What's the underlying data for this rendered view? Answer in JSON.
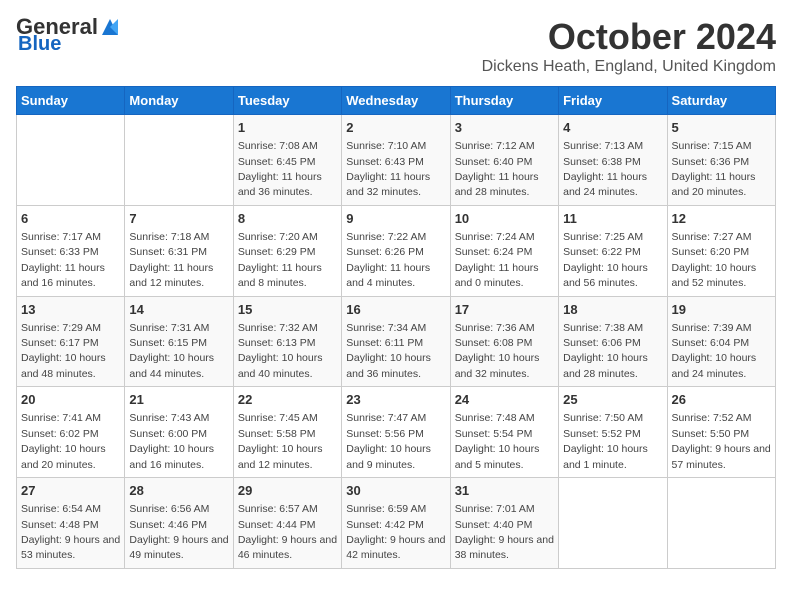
{
  "header": {
    "logo_general": "General",
    "logo_blue": "Blue",
    "main_title": "October 2024",
    "subtitle": "Dickens Heath, England, United Kingdom"
  },
  "days_of_week": [
    "Sunday",
    "Monday",
    "Tuesday",
    "Wednesday",
    "Thursday",
    "Friday",
    "Saturday"
  ],
  "weeks": [
    [
      {
        "day": "",
        "info": ""
      },
      {
        "day": "",
        "info": ""
      },
      {
        "day": "1",
        "info": "Sunrise: 7:08 AM\nSunset: 6:45 PM\nDaylight: 11 hours and 36 minutes."
      },
      {
        "day": "2",
        "info": "Sunrise: 7:10 AM\nSunset: 6:43 PM\nDaylight: 11 hours and 32 minutes."
      },
      {
        "day": "3",
        "info": "Sunrise: 7:12 AM\nSunset: 6:40 PM\nDaylight: 11 hours and 28 minutes."
      },
      {
        "day": "4",
        "info": "Sunrise: 7:13 AM\nSunset: 6:38 PM\nDaylight: 11 hours and 24 minutes."
      },
      {
        "day": "5",
        "info": "Sunrise: 7:15 AM\nSunset: 6:36 PM\nDaylight: 11 hours and 20 minutes."
      }
    ],
    [
      {
        "day": "6",
        "info": "Sunrise: 7:17 AM\nSunset: 6:33 PM\nDaylight: 11 hours and 16 minutes."
      },
      {
        "day": "7",
        "info": "Sunrise: 7:18 AM\nSunset: 6:31 PM\nDaylight: 11 hours and 12 minutes."
      },
      {
        "day": "8",
        "info": "Sunrise: 7:20 AM\nSunset: 6:29 PM\nDaylight: 11 hours and 8 minutes."
      },
      {
        "day": "9",
        "info": "Sunrise: 7:22 AM\nSunset: 6:26 PM\nDaylight: 11 hours and 4 minutes."
      },
      {
        "day": "10",
        "info": "Sunrise: 7:24 AM\nSunset: 6:24 PM\nDaylight: 11 hours and 0 minutes."
      },
      {
        "day": "11",
        "info": "Sunrise: 7:25 AM\nSunset: 6:22 PM\nDaylight: 10 hours and 56 minutes."
      },
      {
        "day": "12",
        "info": "Sunrise: 7:27 AM\nSunset: 6:20 PM\nDaylight: 10 hours and 52 minutes."
      }
    ],
    [
      {
        "day": "13",
        "info": "Sunrise: 7:29 AM\nSunset: 6:17 PM\nDaylight: 10 hours and 48 minutes."
      },
      {
        "day": "14",
        "info": "Sunrise: 7:31 AM\nSunset: 6:15 PM\nDaylight: 10 hours and 44 minutes."
      },
      {
        "day": "15",
        "info": "Sunrise: 7:32 AM\nSunset: 6:13 PM\nDaylight: 10 hours and 40 minutes."
      },
      {
        "day": "16",
        "info": "Sunrise: 7:34 AM\nSunset: 6:11 PM\nDaylight: 10 hours and 36 minutes."
      },
      {
        "day": "17",
        "info": "Sunrise: 7:36 AM\nSunset: 6:08 PM\nDaylight: 10 hours and 32 minutes."
      },
      {
        "day": "18",
        "info": "Sunrise: 7:38 AM\nSunset: 6:06 PM\nDaylight: 10 hours and 28 minutes."
      },
      {
        "day": "19",
        "info": "Sunrise: 7:39 AM\nSunset: 6:04 PM\nDaylight: 10 hours and 24 minutes."
      }
    ],
    [
      {
        "day": "20",
        "info": "Sunrise: 7:41 AM\nSunset: 6:02 PM\nDaylight: 10 hours and 20 minutes."
      },
      {
        "day": "21",
        "info": "Sunrise: 7:43 AM\nSunset: 6:00 PM\nDaylight: 10 hours and 16 minutes."
      },
      {
        "day": "22",
        "info": "Sunrise: 7:45 AM\nSunset: 5:58 PM\nDaylight: 10 hours and 12 minutes."
      },
      {
        "day": "23",
        "info": "Sunrise: 7:47 AM\nSunset: 5:56 PM\nDaylight: 10 hours and 9 minutes."
      },
      {
        "day": "24",
        "info": "Sunrise: 7:48 AM\nSunset: 5:54 PM\nDaylight: 10 hours and 5 minutes."
      },
      {
        "day": "25",
        "info": "Sunrise: 7:50 AM\nSunset: 5:52 PM\nDaylight: 10 hours and 1 minute."
      },
      {
        "day": "26",
        "info": "Sunrise: 7:52 AM\nSunset: 5:50 PM\nDaylight: 9 hours and 57 minutes."
      }
    ],
    [
      {
        "day": "27",
        "info": "Sunrise: 6:54 AM\nSunset: 4:48 PM\nDaylight: 9 hours and 53 minutes."
      },
      {
        "day": "28",
        "info": "Sunrise: 6:56 AM\nSunset: 4:46 PM\nDaylight: 9 hours and 49 minutes."
      },
      {
        "day": "29",
        "info": "Sunrise: 6:57 AM\nSunset: 4:44 PM\nDaylight: 9 hours and 46 minutes."
      },
      {
        "day": "30",
        "info": "Sunrise: 6:59 AM\nSunset: 4:42 PM\nDaylight: 9 hours and 42 minutes."
      },
      {
        "day": "31",
        "info": "Sunrise: 7:01 AM\nSunset: 4:40 PM\nDaylight: 9 hours and 38 minutes."
      },
      {
        "day": "",
        "info": ""
      },
      {
        "day": "",
        "info": ""
      }
    ]
  ]
}
